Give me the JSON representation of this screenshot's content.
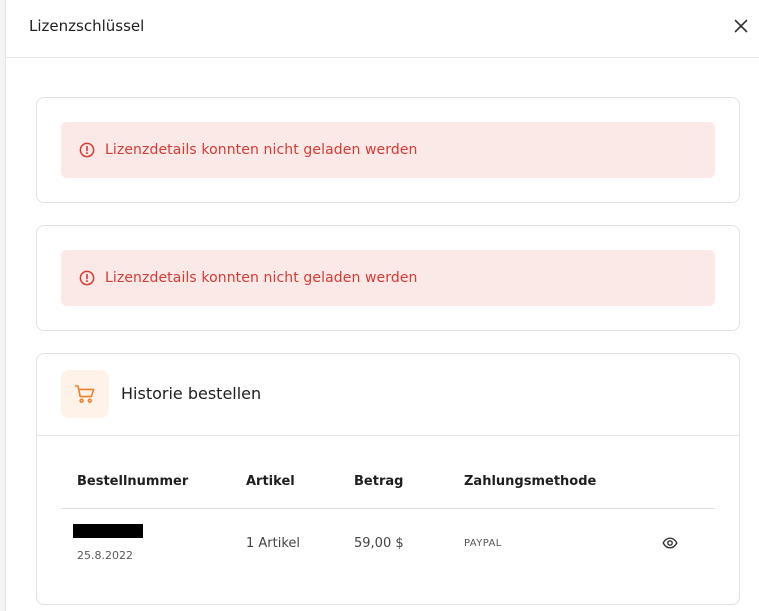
{
  "header": {
    "title": "Lizenzschlüssel",
    "close_icon": "close-icon"
  },
  "errors": [
    {
      "message": "Lizenzdetails konnten nicht geladen werden",
      "icon": "alert-circle-icon"
    },
    {
      "message": "Lizenzdetails konnten nicht geladen werden",
      "icon": "alert-circle-icon"
    }
  ],
  "orders": {
    "title": "Historie bestellen",
    "icon": "shopping-cart-icon",
    "columns": {
      "order_number": "Bestellnummer",
      "items": "Artikel",
      "amount": "Betrag",
      "payment_method": "Zahlungsmethode"
    },
    "rows": [
      {
        "date": "25.8.2022",
        "items": "1 Artikel",
        "amount": "59,00 $",
        "payment_method": "PAYPAL",
        "action_icon": "eye-icon"
      }
    ]
  },
  "colors": {
    "error_text": "#d63a34",
    "error_background": "#fbe9e8",
    "accent_orange": "#f07f2e",
    "icon_box_background": "#fff2e9"
  }
}
